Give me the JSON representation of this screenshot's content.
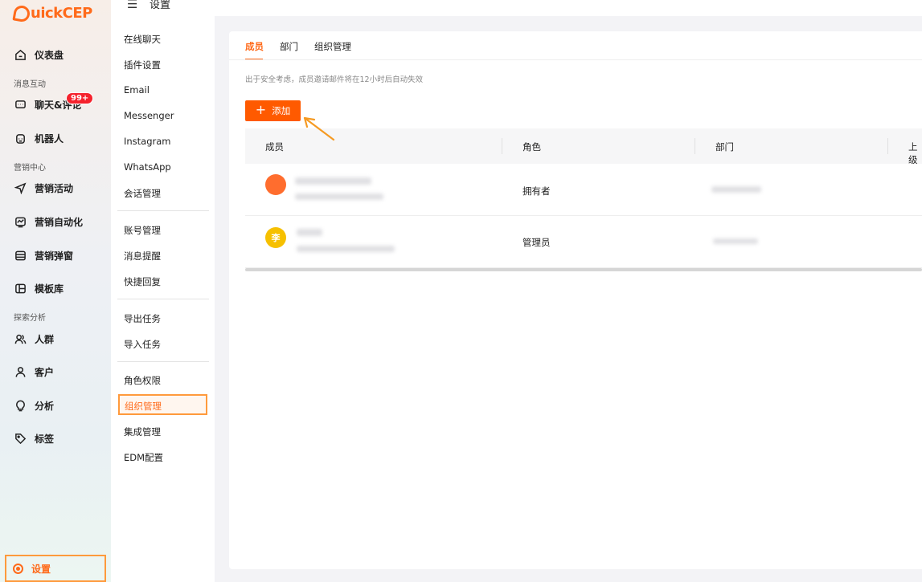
{
  "brand": {
    "logo_text": "uickCEP",
    "accent": "#ff6a1a"
  },
  "topbar": {
    "menu_icon": "menu-collapse-icon",
    "title": "设置"
  },
  "sidebar": {
    "items": [
      {
        "label": "仪表盘",
        "icon": "home-icon"
      },
      {
        "label": "聊天&评论",
        "icon": "chat-icon",
        "badge": "99+"
      },
      {
        "label": "机器人",
        "icon": "robot-icon"
      },
      {
        "label": "营销活动",
        "icon": "send-icon"
      },
      {
        "label": "营销自动化",
        "icon": "automation-icon"
      },
      {
        "label": "营销弹窗",
        "icon": "popup-icon"
      },
      {
        "label": "模板库",
        "icon": "template-icon"
      },
      {
        "label": "人群",
        "icon": "people-icon"
      },
      {
        "label": "客户",
        "icon": "user-icon"
      },
      {
        "label": "分析",
        "icon": "bulb-icon"
      },
      {
        "label": "标签",
        "icon": "tag-icon"
      }
    ],
    "sections": [
      "消息互动",
      "营销中心",
      "探索分析"
    ],
    "settings_label": "设置"
  },
  "submenu": {
    "items": [
      "在线聊天",
      "插件设置",
      "Email",
      "Messenger",
      "Instagram",
      "WhatsApp",
      "会话管理",
      "账号管理",
      "消息提醒",
      "快捷回复",
      "导出任务",
      "导入任务",
      "角色权限",
      "组织管理",
      "集成管理",
      "EDM配置"
    ],
    "active": "组织管理"
  },
  "main": {
    "tabs": [
      "成员",
      "部门",
      "组织管理"
    ],
    "active_tab": "成员",
    "notice": "出于安全考虑，成员邀请邮件将在12小时后自动失效",
    "add_label": "添加",
    "table": {
      "headers": [
        "成员",
        "角色",
        "部门",
        "上级"
      ],
      "rows": [
        {
          "avatar_text": "",
          "avatar_color": "#ff6d2e",
          "role": "拥有者"
        },
        {
          "avatar_text": "李",
          "avatar_color": "#f6c000",
          "role": "管理员"
        }
      ]
    }
  }
}
